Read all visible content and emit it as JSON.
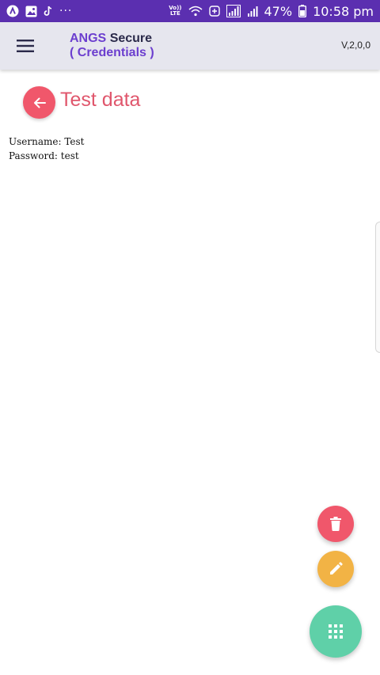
{
  "status_bar": {
    "more_dots": "···",
    "volte_top": "Vo))",
    "volte_bottom": "LTE",
    "battery_percent": "47%",
    "time": "10:58 pm"
  },
  "app_bar": {
    "title_brand": "ANGS",
    "title_secure": "Secure",
    "title_line2": "( Credentials )",
    "version": "V,2,0,0"
  },
  "page": {
    "title": "Test data",
    "username_line": "Username: Test",
    "password_line": "Password: test"
  },
  "colors": {
    "status_bar": "#5b2fb0",
    "app_bar": "#e6e6ee",
    "accent_red": "#f0576b",
    "accent_orange": "#f2b345",
    "accent_green": "#5fd0a8",
    "brand_purple": "#6c3fcf"
  },
  "icons": {
    "back": "arrow-left-icon",
    "menu": "hamburger-icon",
    "delete": "trash-icon",
    "edit": "pencil-icon",
    "apps": "grid-icon"
  }
}
